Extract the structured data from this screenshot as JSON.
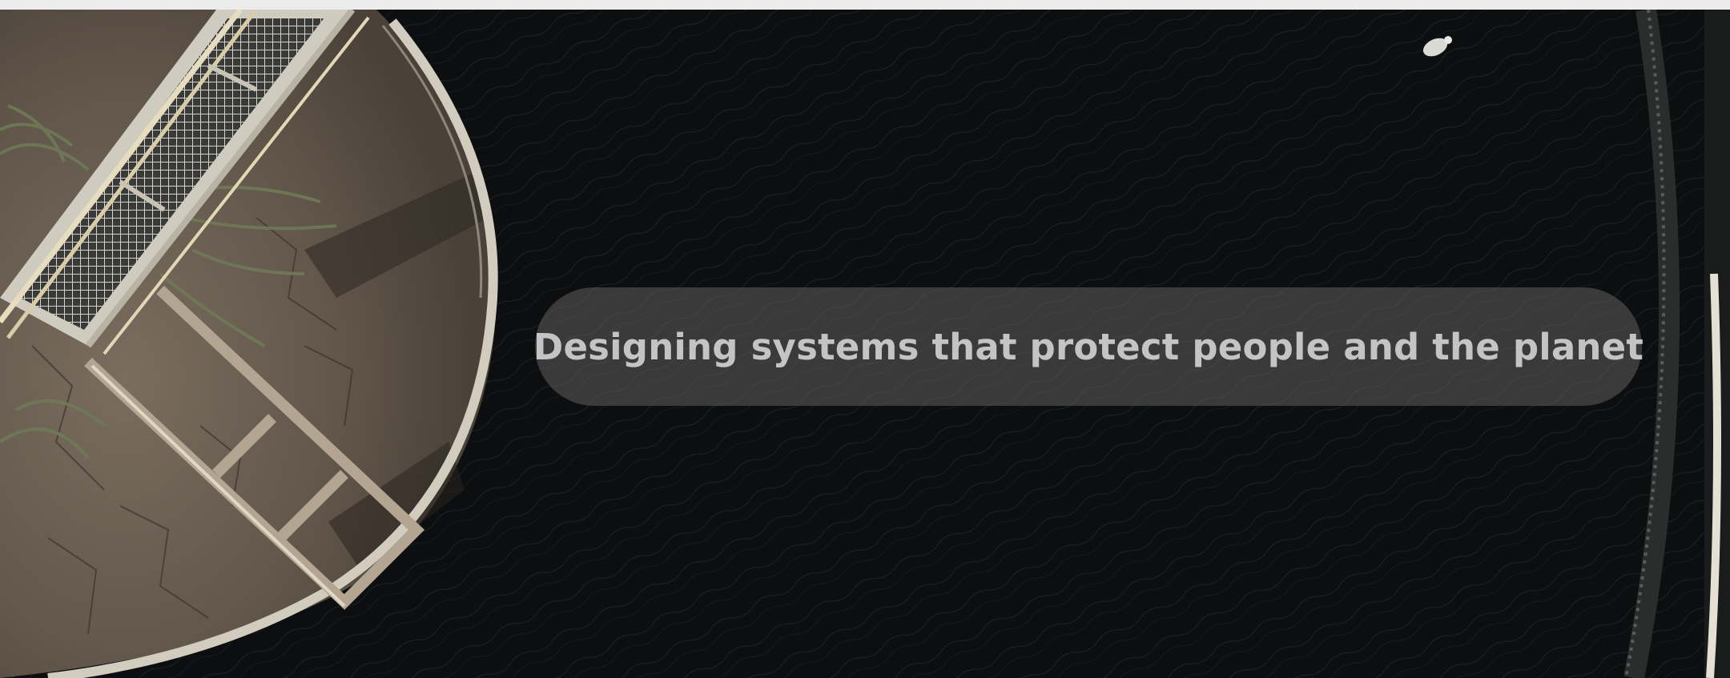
{
  "hero": {
    "tagline": "Designing systems that protect people and the planet",
    "image_subject": "aerial-tank-photo"
  },
  "colors": {
    "water": "#0d0f10",
    "ground": "#6b5f52",
    "walkway": "#d8d4c8",
    "rim": "#c9c4b8",
    "pill": "#5c5c5c",
    "tagline_text": "#c4c4c4"
  }
}
